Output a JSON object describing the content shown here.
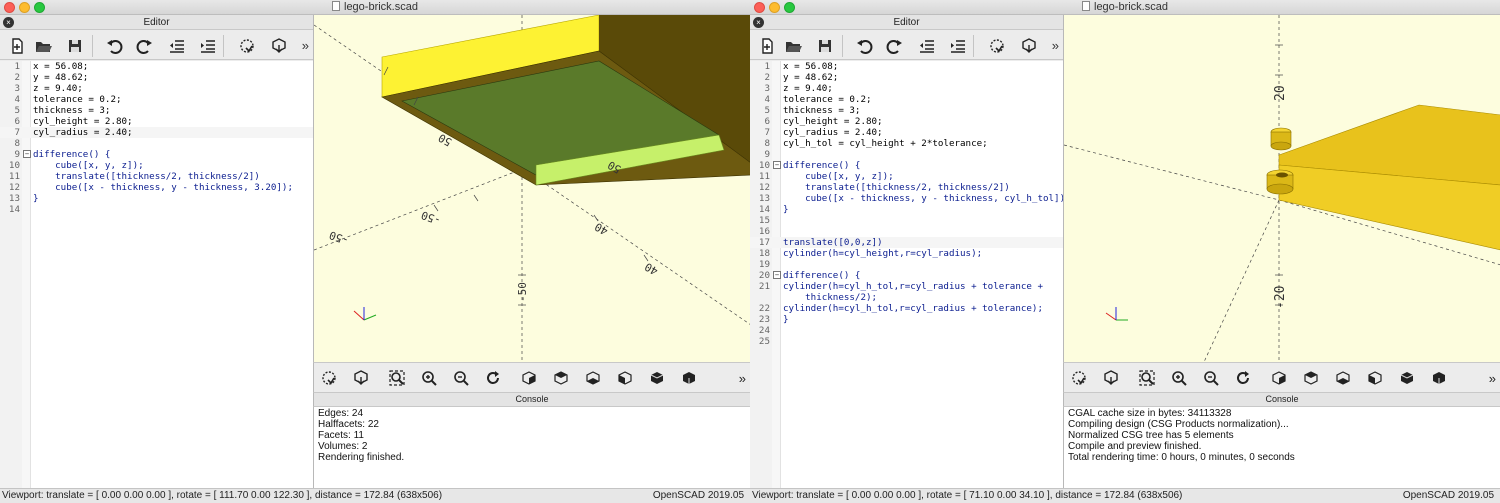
{
  "left": {
    "window_title": "lego-brick.scad",
    "editor_title": "Editor",
    "console_title": "Console",
    "code": [
      {
        "n": "1",
        "text": "x = 56.08;",
        "kind": "plain",
        "fold": ""
      },
      {
        "n": "2",
        "text": "y = 48.62;",
        "kind": "plain",
        "fold": ""
      },
      {
        "n": "3",
        "text": "z = 9.40;",
        "kind": "plain",
        "fold": ""
      },
      {
        "n": "4",
        "text": "tolerance = 0.2;",
        "kind": "plain",
        "fold": ""
      },
      {
        "n": "5",
        "text": "thickness = 3;",
        "kind": "plain",
        "fold": ""
      },
      {
        "n": "6",
        "text": "cyl_height = 2.80;",
        "kind": "plain",
        "fold": ""
      },
      {
        "n": "7",
        "text": "cyl_radius = 2.40;",
        "kind": "plain",
        "fold": "",
        "current": true
      },
      {
        "n": "8",
        "text": "",
        "kind": "plain",
        "fold": ""
      },
      {
        "n": "9",
        "text": "difference() {",
        "kind": "kw",
        "fold": "−"
      },
      {
        "n": "10",
        "text": "    cube([x, y, z]);",
        "kind": "kw",
        "fold": ""
      },
      {
        "n": "11",
        "text": "    translate([thickness/2, thickness/2])",
        "kind": "kw",
        "fold": ""
      },
      {
        "n": "12",
        "text": "    cube([x - thickness, y - thickness, 3.20]);",
        "kind": "kw",
        "fold": ""
      },
      {
        "n": "13",
        "text": "}",
        "kind": "kw",
        "fold": ""
      },
      {
        "n": "14",
        "text": "",
        "kind": "plain",
        "fold": ""
      }
    ],
    "console_lines": [
      "Edges: 24",
      "Halffacets: 22",
      "Facets: 11",
      "Volumes: 2",
      "Rendering finished."
    ],
    "status": "Viewport: translate = [ 0.00 0.00 0.00 ], rotate = [ 111.70 0.00 122.30 ], distance = 172.84 (638x506)",
    "version": "OpenSCAD 2019.05",
    "axis_labels": [
      "50",
      "50",
      "-50",
      "-50",
      "40",
      "40",
      "-50"
    ]
  },
  "right": {
    "window_title": "lego-brick.scad",
    "editor_title": "Editor",
    "console_title": "Console",
    "code": [
      {
        "n": "1",
        "text": "x = 56.08;",
        "kind": "plain",
        "fold": ""
      },
      {
        "n": "2",
        "text": "y = 48.62;",
        "kind": "plain",
        "fold": ""
      },
      {
        "n": "3",
        "text": "z = 9.40;",
        "kind": "plain",
        "fold": ""
      },
      {
        "n": "4",
        "text": "tolerance = 0.2;",
        "kind": "plain",
        "fold": ""
      },
      {
        "n": "5",
        "text": "thickness = 3;",
        "kind": "plain",
        "fold": ""
      },
      {
        "n": "6",
        "text": "cyl_height = 2.80;",
        "kind": "plain",
        "fold": ""
      },
      {
        "n": "7",
        "text": "cyl_radius = 2.40;",
        "kind": "plain",
        "fold": ""
      },
      {
        "n": "8",
        "text": "cyl_h_tol = cyl_height + 2*tolerance;",
        "kind": "plain",
        "fold": ""
      },
      {
        "n": "9",
        "text": "",
        "kind": "plain",
        "fold": ""
      },
      {
        "n": "10",
        "text": "difference() {",
        "kind": "kw",
        "fold": "−"
      },
      {
        "n": "11",
        "text": "    cube([x, y, z]);",
        "kind": "kw",
        "fold": ""
      },
      {
        "n": "12",
        "text": "    translate([thickness/2, thickness/2])",
        "kind": "kw",
        "fold": ""
      },
      {
        "n": "13",
        "text": "    cube([x - thickness, y - thickness, cyl_h_tol]);",
        "kind": "kw",
        "fold": ""
      },
      {
        "n": "14",
        "text": "}",
        "kind": "kw",
        "fold": ""
      },
      {
        "n": "15",
        "text": "",
        "kind": "plain",
        "fold": ""
      },
      {
        "n": "16",
        "text": "",
        "kind": "plain",
        "fold": ""
      },
      {
        "n": "17",
        "text": "translate([0,0,z])",
        "kind": "kw",
        "fold": "",
        "current": true
      },
      {
        "n": "18",
        "text": "cylinder(h=cyl_height,r=cyl_radius);",
        "kind": "kw",
        "fold": ""
      },
      {
        "n": "19",
        "text": "",
        "kind": "plain",
        "fold": ""
      },
      {
        "n": "20",
        "text": "difference() {",
        "kind": "kw",
        "fold": "−"
      },
      {
        "n": "21",
        "text": "cylinder(h=cyl_h_tol,r=cyl_radius + tolerance +",
        "kind": "kw",
        "fold": ""
      },
      {
        "n": "",
        "text": "    thickness/2);",
        "kind": "kw",
        "fold": ""
      },
      {
        "n": "22",
        "text": "cylinder(h=cyl_h_tol,r=cyl_radius + tolerance);",
        "kind": "kw",
        "fold": ""
      },
      {
        "n": "23",
        "text": "}",
        "kind": "kw",
        "fold": ""
      },
      {
        "n": "24",
        "text": "",
        "kind": "plain",
        "fold": ""
      },
      {
        "n": "25",
        "text": "",
        "kind": "plain",
        "fold": ""
      }
    ],
    "console_lines": [
      "CGAL cache size in bytes: 34113328",
      "Compiling design (CSG Products normalization)...",
      "Normalized CSG tree has 5 elements",
      "Compile and preview finished.",
      "Total rendering time: 0 hours, 0 minutes, 0 seconds"
    ],
    "status": "Viewport: translate = [ 0.00 0.00 0.00 ], rotate = [ 71.10 0.00 34.10 ], distance = 172.84 (638x506)",
    "version": "OpenSCAD 2019.05",
    "axis_labels": [
      "20",
      "-20"
    ]
  },
  "colors": {
    "viewport_bg": "#fdfdde",
    "brick_top": "#fdf233",
    "brick_side": "#5a4a08",
    "cavity": "#5a7a2a",
    "cut_face": "#c6f06a",
    "code_keyword": "#0b1d8f"
  },
  "icons": {
    "editor_toolbar": [
      "new-file-icon",
      "open-folder-icon",
      "save-icon",
      "undo-icon",
      "redo-icon",
      "unindent-icon",
      "indent-icon",
      "preview-icon",
      "render-icon"
    ],
    "viewport_toolbar": [
      "preview-icon",
      "render-icon",
      "zoom-all-icon",
      "zoom-in-icon",
      "zoom-out-icon",
      "reset-view-icon",
      "view-right-icon",
      "view-top-icon",
      "view-bottom-icon",
      "view-left-icon",
      "view-front-icon",
      "view-back-icon"
    ]
  },
  "more_glyph": "»"
}
